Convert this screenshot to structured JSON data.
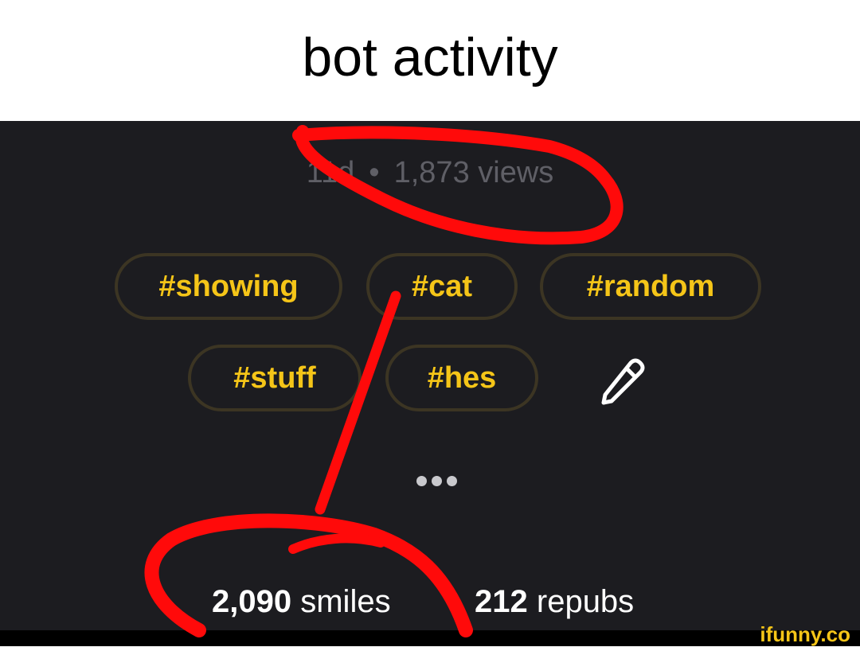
{
  "caption": "bot activity",
  "post_meta": {
    "age": "11d",
    "separator": "•",
    "views": "1,873 views"
  },
  "tags": [
    "#showing",
    "#cat",
    "#random",
    "#stuff",
    "#hes"
  ],
  "edit_icon": "pencil-icon",
  "more_icon": "ellipsis-icon",
  "stats": {
    "smiles_count": "2,090",
    "smiles_label": "smiles",
    "repubs_count": "212",
    "repubs_label": "repubs"
  },
  "watermark": "ifunny.co",
  "colors": {
    "panel_bg": "#1c1c20",
    "tag_text": "#f5c518",
    "tag_border": "#3c3523",
    "meta_text": "#5f5f66",
    "scribble": "#ff0a0a"
  }
}
